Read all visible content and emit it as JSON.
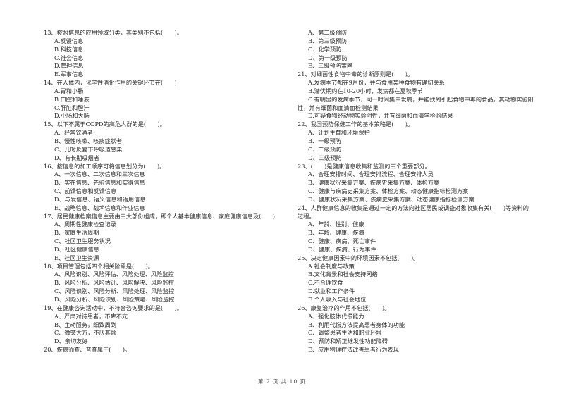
{
  "left_column": [
    {
      "type": "q",
      "text": "13、按照信息的应用领域分类，其类别不包括(　　)。"
    },
    {
      "type": "opt",
      "text": "A.反馈信息"
    },
    {
      "type": "opt",
      "text": "B.科技信息"
    },
    {
      "type": "opt",
      "text": "C.社会信息"
    },
    {
      "type": "opt",
      "text": "D.管理信息"
    },
    {
      "type": "opt",
      "text": "E.军事信息"
    },
    {
      "type": "q",
      "text": "14、在人体内，化学性消化作用的关键环节在(　　)"
    },
    {
      "type": "opt",
      "text": "A.胃和小肠"
    },
    {
      "type": "opt",
      "text": "B.口腔和唾液"
    },
    {
      "type": "opt",
      "text": "C.肝脏和胆汁"
    },
    {
      "type": "opt",
      "text": "D.小肠和大肠"
    },
    {
      "type": "q",
      "text": "15、以下不属于COPD的高危人群的是(　　)。"
    },
    {
      "type": "opt",
      "text": "A、经常饮酒者"
    },
    {
      "type": "opt",
      "text": "B、慢性咳嗽、咳痰症状者"
    },
    {
      "type": "opt",
      "text": "C、儿时反复下呼吸道感染"
    },
    {
      "type": "opt",
      "text": "D、有长期吸烟者"
    },
    {
      "type": "q",
      "text": "16、按信息的加工顺序可将信息划分为(　　)。"
    },
    {
      "type": "opt",
      "text": "A、一次信息、二次信息和三次信息"
    },
    {
      "type": "opt",
      "text": "B、实在信息、先验信息和实得信息"
    },
    {
      "type": "opt",
      "text": "C、前馈信息和反馈信息"
    },
    {
      "type": "opt",
      "text": "D、与发信息、语义信息和语用信息"
    },
    {
      "type": "opt",
      "text": "E、战略信息、战术信息和作业信息"
    },
    {
      "type": "q",
      "text": "17、居民健康档案信息主要由三大部份组成，即个人基本健康信息、家庭健康信息及(　　)"
    },
    {
      "type": "opt",
      "text": "A、周期性健康检查记录"
    },
    {
      "type": "opt",
      "text": "B、家庭生活周期"
    },
    {
      "type": "opt",
      "text": "C、社区卫生服务状况"
    },
    {
      "type": "opt",
      "text": "D、社区健康信息"
    },
    {
      "type": "opt",
      "text": "E、社区卫生资源"
    },
    {
      "type": "q",
      "text": "18、项目管理包括四个相关阶段是(　　)。"
    },
    {
      "type": "opt",
      "text": "A、风险识别、风险评估、风险处理、风险监控"
    },
    {
      "type": "opt",
      "text": "B、风险分析、风险估计、风险解决、风险监控"
    },
    {
      "type": "opt",
      "text": "C、风险识别、风险分析、风险处理、风险监控"
    },
    {
      "type": "opt",
      "text": "D、风险分析、风险识别、风险策略、风险监控"
    },
    {
      "type": "q",
      "text": "19、在健康咨询活动中，不符合咨询要求的是(　　)。"
    },
    {
      "type": "opt",
      "text": "A、严肃对待患者，不卑不亢"
    },
    {
      "type": "opt",
      "text": "B、主动服务，细致周到"
    },
    {
      "type": "opt",
      "text": "C、微笑大方，不厌其烦"
    },
    {
      "type": "opt",
      "text": "D、亲切友好"
    },
    {
      "type": "q",
      "text": "20、疾病筛查、普查属于(　　)。"
    }
  ],
  "right_column": [
    {
      "type": "opt",
      "text": "A、第二级预防"
    },
    {
      "type": "opt",
      "text": "B、第三级预防"
    },
    {
      "type": "opt",
      "text": "C、化学预防"
    },
    {
      "type": "opt",
      "text": "D、第一级预防"
    },
    {
      "type": "opt",
      "text": "E、三级预防策略"
    },
    {
      "type": "q",
      "text": "21、对细菌性食物中毒的诊断原则是(　　)。"
    },
    {
      "type": "opt",
      "text": "A.发病季节都在9月份，并与食用某种食物有确切关系"
    },
    {
      "type": "opt",
      "text": "B.潜伏期约在10-20小时，发病都在夏秋季节"
    },
    {
      "type": "wrap-first",
      "text": "C.有明显的发病季节，同一时间集中发病，并能找到引起食物中毒的食品，其动物实验阳"
    },
    {
      "type": "wrap-cont",
      "text": "性，并有细菌和血清血检测结果"
    },
    {
      "type": "opt",
      "text": "D.可疑食物经动物实验阴性，并有细菌和血清学检验结果"
    },
    {
      "type": "q",
      "text": "22、我国预防保健工作的基本策略是(　　)。"
    },
    {
      "type": "opt",
      "text": "A、计划生育和环境保护"
    },
    {
      "type": "opt",
      "text": "B、一级预防"
    },
    {
      "type": "opt",
      "text": "C、二级预防"
    },
    {
      "type": "opt",
      "text": "D、三级预防"
    },
    {
      "type": "q",
      "text": "23、(　　)是健康信息收集和监测的三个重要部分。"
    },
    {
      "type": "opt",
      "text": "A、合理安排时间、合理安排流程、合理安排人员"
    },
    {
      "type": "opt",
      "text": "B、健康状况采集方案、疾病史采集方案、体检方案"
    },
    {
      "type": "opt",
      "text": "C、健康与疾病史采集方案、体检方案、动态健康指标检测方案"
    },
    {
      "type": "opt",
      "text": "D、健康状况采集方案、疾病史采集方案、动态健康指标检测方案"
    },
    {
      "type": "q",
      "text": "24、人群健康信息的收集是通过一定的方法向社区居民或调查对象收集有关(　　)等资料的"
    },
    {
      "type": "wrap-cont",
      "text": "过程。"
    },
    {
      "type": "opt",
      "text": "A、年龄、性别、健康"
    },
    {
      "type": "opt",
      "text": "B、年龄、健康、疾病"
    },
    {
      "type": "opt",
      "text": "C、健康、疾病、死亡事件"
    },
    {
      "type": "opt",
      "text": "D、健康、疾病、行为事件"
    },
    {
      "type": "q",
      "text": "25、决定健康因素中的环境因素不包括(　　)。"
    },
    {
      "type": "opt",
      "text": "A.社会制度与政策"
    },
    {
      "type": "opt",
      "text": "B.文化背景和社会支持网络"
    },
    {
      "type": "opt",
      "text": "C.不合理饮食"
    },
    {
      "type": "opt",
      "text": "D.就业和工作条件"
    },
    {
      "type": "opt",
      "text": "E.个人收入与社会地位"
    },
    {
      "type": "q",
      "text": "26、康复治疗的作用不包括(　　)。"
    },
    {
      "type": "opt",
      "text": "A、强化肢体代偿能力"
    },
    {
      "type": "opt",
      "text": "B、利用代偿方法提高患者身体的功能"
    },
    {
      "type": "opt",
      "text": "C、调整患者生活和职业环境"
    },
    {
      "type": "opt",
      "text": "D、预防和矫正继发性功能障碍"
    },
    {
      "type": "opt",
      "text": "E、应用物理疗法改善患者行为表现"
    }
  ],
  "footer": {
    "page_label": "第 2 页 共 10 页"
  }
}
